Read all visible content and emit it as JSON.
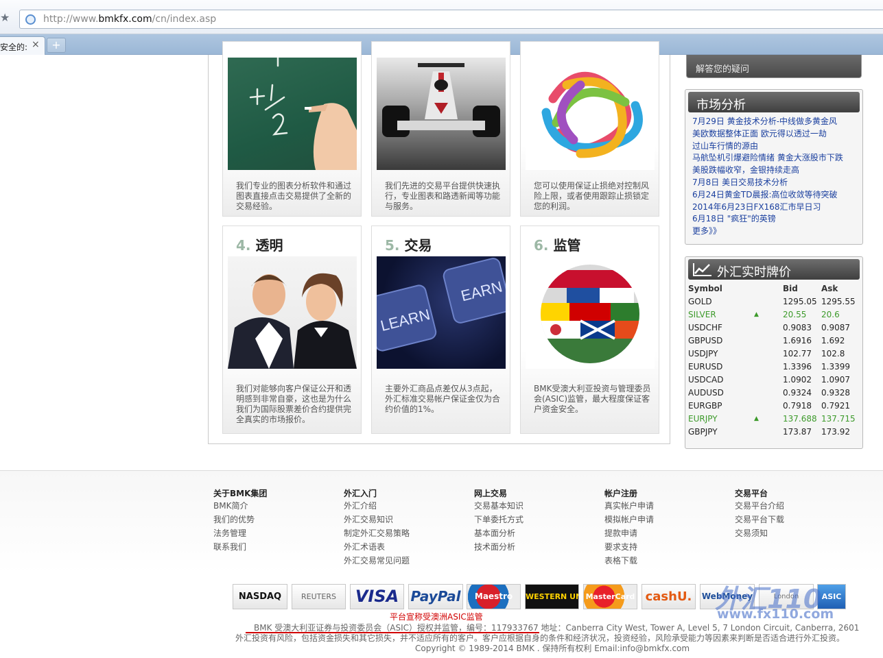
{
  "browser": {
    "url_prefix": "http://www.",
    "url_domain": "bmkfx.com",
    "url_path": "/cn/index.asp",
    "tab_label": "安全的:",
    "tab_close": "×",
    "new_tab": "+"
  },
  "features": {
    "row1": [
      {
        "text": "我们专业的图表分析软件和通过图表直接点击交易提供了全新的交易经验。"
      },
      {
        "text": "我们先进的交易平台提供快速执行，专业图表和路透新闻等功能与服务。"
      },
      {
        "text": "您可以使用保证止损绝对控制风险上限，或者使用跟踪止损锁定您的利润。"
      }
    ],
    "row2": [
      {
        "num": "4.",
        "title": "透明",
        "text": "我们对能够向客户保证公开和透明感到非常自豪，这也是为什么我们为国际股票差价合约提供完全真实的市场报价。"
      },
      {
        "num": "5.",
        "title": "交易",
        "text": "主要外汇商品点差仅从3点起，外汇标准交易帐户保证金仅为合约价值的1%。"
      },
      {
        "num": "6.",
        "title": "监管",
        "text": "BMK受澳大利亚投资与管理委员会(ASIC)监管，最大程度保证客户资金安全。"
      }
    ],
    "chalk_text": "+ 1 / 2",
    "keys": [
      "LEARN",
      "EARN"
    ]
  },
  "sidebar": {
    "banner_text": "解答您的疑问",
    "market": {
      "title": "市场分析",
      "items": [
        "7月29日 黄金技术分析-中线做多黄金风",
        "美欧数据整体正面 欧元得以透过一劫",
        "过山车行情的源由",
        "马航坠机引爆避险情绪 黄金大涨股市下跌",
        "美股跌幅收窄，金银持续走高",
        "7月8日 美日交易技术分析",
        "6月24日黄金TD晨报:高位收敛等待突破",
        "2014年6月23日FX168汇市早日习",
        "6月18日 \"疯狂\"的英镑",
        "更多》》"
      ]
    },
    "quotes": {
      "title": "外汇实时牌价",
      "headers": [
        "Symbol",
        "",
        "Bid",
        "Ask"
      ],
      "rows": [
        {
          "symbol": "GOLD",
          "arrow": "",
          "bid": "1295.05",
          "ask": "1295.55",
          "up": false
        },
        {
          "symbol": "SILVER",
          "arrow": "▲",
          "bid": "20.55",
          "ask": "20.6",
          "up": true
        },
        {
          "symbol": "USDCHF",
          "arrow": "",
          "bid": "0.9083",
          "ask": "0.9087",
          "up": false
        },
        {
          "symbol": "GBPUSD",
          "arrow": "",
          "bid": "1.6916",
          "ask": "1.692",
          "up": false
        },
        {
          "symbol": "USDJPY",
          "arrow": "",
          "bid": "102.77",
          "ask": "102.8",
          "up": false
        },
        {
          "symbol": "EURUSD",
          "arrow": "",
          "bid": "1.3396",
          "ask": "1.3399",
          "up": false
        },
        {
          "symbol": "USDCAD",
          "arrow": "",
          "bid": "1.0902",
          "ask": "1.0907",
          "up": false
        },
        {
          "symbol": "AUDUSD",
          "arrow": "",
          "bid": "0.9324",
          "ask": "0.9328",
          "up": false
        },
        {
          "symbol": "EURGBP",
          "arrow": "",
          "bid": "0.7918",
          "ask": "0.7921",
          "up": false
        },
        {
          "symbol": "EURJPY",
          "arrow": "▲",
          "bid": "137.688",
          "ask": "137.715",
          "up": true
        },
        {
          "symbol": "GBPJPY",
          "arrow": "",
          "bid": "173.87",
          "ask": "173.92",
          "up": false
        }
      ]
    }
  },
  "footer": {
    "columns": [
      {
        "head": "关于BMK集团",
        "links": [
          "BMK简介",
          "我们的优势",
          "法务管理",
          "联系我们"
        ]
      },
      {
        "head": "外汇入门",
        "links": [
          "外汇介绍",
          "外汇交易知识",
          "制定外汇交易策略",
          "外汇术语表",
          "外汇交易常见问题"
        ]
      },
      {
        "head": "网上交易",
        "links": [
          "交易基本知识",
          "下单委托方式",
          "基本面分析",
          "技术面分析"
        ]
      },
      {
        "head": "帐户注册",
        "links": [
          "真实帐户申请",
          "模拟帐户申请",
          "提款申请",
          "要求支持",
          "表格下载"
        ]
      },
      {
        "head": "交易平台",
        "links": [
          "交易平台介绍",
          "交易平台下载",
          "交易须知"
        ]
      }
    ],
    "logos": [
      "NASDAQ",
      "REUTERS",
      "VISA",
      "PayPal",
      "Maestro",
      "WESTERN UNION",
      "MasterCard",
      "cashU.",
      "WebMoney",
      "London",
      "ASIC"
    ],
    "red_note": "平台宣称受澳洲ASIC监管",
    "asic_line": "BMK 受澳大利亚证券与投资委员会（ASIC）授权并监管，编号：117933767 地址：Canberra City West, Tower A, Level 5, 7 London Circuit, Canberra, 2601",
    "risk_line": "外汇投资有风险，包括资金损失和其它损失，并不适应所有的客户。客户应根据自身的条件和经济状况，投资经验，风险承受能力等因素来判断是否适合进行外汇投资。",
    "copyright": "Copyright © 1989-2014 BMK . 保持所有权利 Email:info@bmkfx.com"
  },
  "watermark": {
    "big": "外汇110",
    "small": "www.fx110.com"
  }
}
